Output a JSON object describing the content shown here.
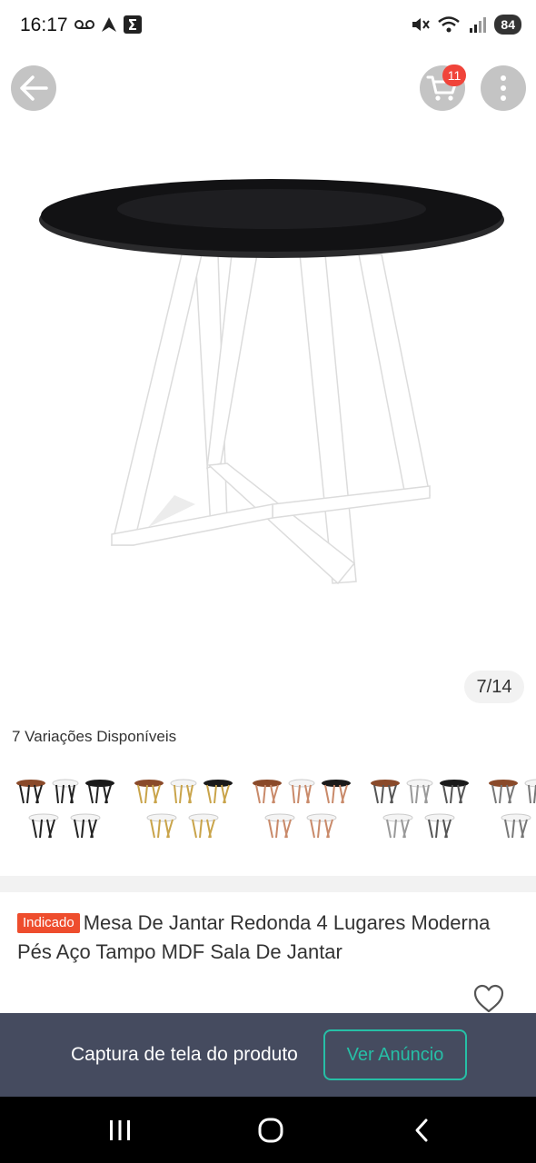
{
  "status_bar": {
    "time": "16:17",
    "battery": "84",
    "left_icons": [
      "voicemail-icon",
      "arrow-app-icon",
      "sigma-app-icon"
    ],
    "right_icons": [
      "mute-icon",
      "wifi-icon",
      "signal-icon"
    ]
  },
  "header": {
    "cart_count": "11"
  },
  "gallery": {
    "counter": "7/14"
  },
  "variations": {
    "label": "7 Variações Disponíveis"
  },
  "product": {
    "badge": "Indicado",
    "title": "Mesa De Jantar Redonda 4 Lugares Moderna Pés Aço Tampo MDF Sala De Jantar"
  },
  "banner": {
    "text": "Captura de tela do produto",
    "button": "Ver Anúncio"
  },
  "colors": {
    "accent": "#26bfa6",
    "badge": "#ee4d2d",
    "cart_badge": "#f0443a",
    "banner_bg": "#454b5f"
  }
}
